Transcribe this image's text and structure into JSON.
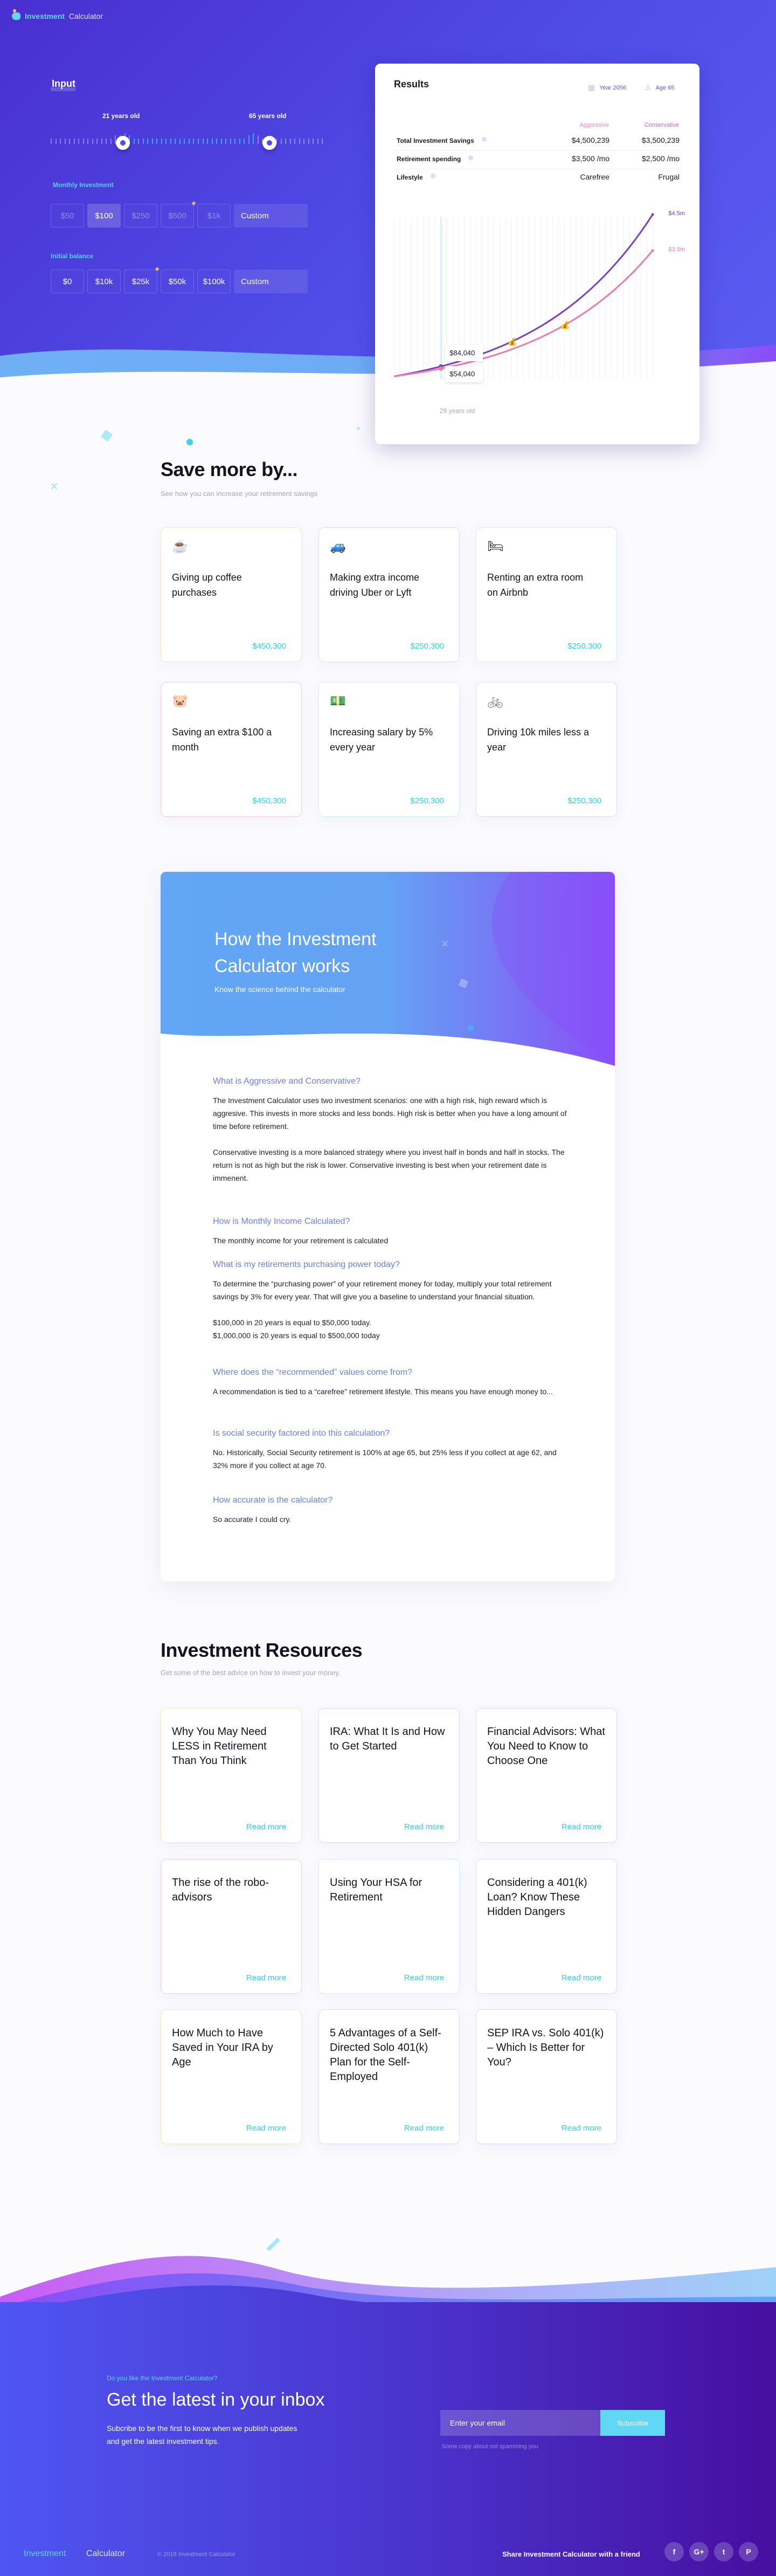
{
  "header": {
    "logo_primary": "Investment",
    "logo_secondary": "Calculator"
  },
  "input": {
    "title": "Input",
    "age_range": {
      "start_label": "21 years old",
      "end_label": "65 years old",
      "start_age": 21,
      "end_age": 65
    },
    "monthly_investment": {
      "label": "Monthly Investment",
      "options": [
        "$50",
        "$100",
        "$250",
        "$500",
        "$1k"
      ],
      "selected": "$100",
      "recommended": "$500",
      "custom_label": "Custom"
    },
    "initial_balance": {
      "label": "Initial balance",
      "options": [
        "$0",
        "$10k",
        "$25k",
        "$50k",
        "$100k"
      ],
      "recommended": "$25k",
      "custom_label": "Custom"
    }
  },
  "results": {
    "title": "Results",
    "year": "Year 2056",
    "age": "Age 65",
    "columns": [
      "Aggressive",
      "Conservative"
    ],
    "column_colors": [
      "#e58ac0",
      "#b56ccc"
    ],
    "rows": [
      {
        "label": "Total Investment Savings",
        "aggressive": "$4,500,239",
        "conservative": "$3,500,239"
      },
      {
        "label": "Retirement spending",
        "aggressive": "$3,500 /mo",
        "conservative": "$2,500 /mo"
      },
      {
        "label": "Lifestyle",
        "aggressive": "Carefree",
        "conservative": "Frugal"
      }
    ]
  },
  "chart_data": {
    "type": "line",
    "title": "",
    "xlabel": "",
    "ylabel": "",
    "x_range": [
      21,
      65
    ],
    "y_range": [
      0,
      4500000
    ],
    "grid": "vertical",
    "hover_label": "29 years old",
    "hover_age": 29,
    "series": [
      {
        "name": "Aggressive",
        "color": "#7a3fc8",
        "end_label": "$4.5m",
        "end_value": 4500000,
        "hover_value": "$84,040",
        "milestone_age": 41
      },
      {
        "name": "Conservative",
        "color": "#f07aa8",
        "end_label": "$3.5m",
        "end_value": 3500000,
        "hover_value": "$54,040",
        "milestone_age": 50
      }
    ]
  },
  "save_more": {
    "title": "Save more by...",
    "subtitle": "See how you can increase your retirement savings",
    "cards": [
      {
        "icon": "coffee-icon",
        "glyph": "☕",
        "title": "Giving up coffee purchases",
        "value": "$450,300",
        "border": "#efe6c8"
      },
      {
        "icon": "car-icon",
        "glyph": "🚙",
        "title": "Making extra income driving Uber or Lyft",
        "value": "$250,300",
        "border": "#efd4f0"
      },
      {
        "icon": "bed-icon",
        "glyph": "🛏",
        "title": "Renting an extra room on Airbnb",
        "value": "$250,300",
        "border": "#d4ecf0"
      },
      {
        "icon": "piggy-bank-icon",
        "glyph": "🐷",
        "title": "Saving an extra $100 a month",
        "value": "$450,300",
        "border": "#f5cde2"
      },
      {
        "icon": "money-icon",
        "glyph": "💵",
        "title": "Increasing salary by 5% every year",
        "value": "$250,300",
        "border": "#d4ecf4"
      },
      {
        "icon": "bicycle-icon",
        "glyph": "🚲",
        "title": "Driving 10k miles less a year",
        "value": "$250,300",
        "border": "#e6d8f0"
      }
    ]
  },
  "how_it_works": {
    "title": "How the Investment Calculator works",
    "subtitle": "Know the science behind the calculator",
    "faqs": [
      {
        "q": "What is Aggressive and Conservative?",
        "a": "The Investment Calculator uses two investment scenarios: one with a high risk, high reward which is aggresive. This invests in more stocks and less bonds. High risk is better when you have a long amount of time before retirement.\n\nConservative investing is a more balanced strategy where you invest half in bonds and half in stocks. The return is not as high but the risk is lower. Conservative investing is best when your retirement date is immenent."
      },
      {
        "q": "How is Monthly Income Calculated?",
        "a": "The monthly income for your retirement is calculated"
      },
      {
        "q": "What is my retirements purchasing power today?",
        "a": "To determine the “purchasing power” of your retirement money for today, multiply your total retirement savings by 3% for every year. That will give you a baseline to understand your financial situation.\n\n$100,000 in 20 years is equal to $50,000 today.\n$1,000,000 is 20 years is equal to $500,000 today"
      },
      {
        "q": "Where does the “recommended” values come from?",
        "a": "A recommendation is tied to a “carefree” retirement lifestyle. This means you have enough money to..."
      },
      {
        "q": "Is social security factored into this calculation?",
        "a": "No. Historically, Social Security retirement is 100% at age 65, but 25% less if you collect at age 62, and 32% more if you collect at age 70."
      },
      {
        "q": "How accurate is the calculator?",
        "a": "So accurate I could cry."
      }
    ]
  },
  "resources": {
    "title": "Investment Resources",
    "subtitle": "Get some of the best advice on how to invest your money.",
    "read_more": "Read more",
    "cards": [
      {
        "title": "Why You May Need LESS in Retirement Than You Think",
        "border": "#efe6c8"
      },
      {
        "title": "IRA: What It Is and How to Get Started",
        "border": "#efd4f0"
      },
      {
        "title": "Financial Advisors: What You Need to Know to Choose One",
        "border": "#e6d8f0"
      },
      {
        "title": "The rise of the robo-advisors",
        "border": "#f5cde2"
      },
      {
        "title": "Using Your HSA for Retirement",
        "border": "#d4ecf4"
      },
      {
        "title": "Considering a 401(k) Loan? Know These Hidden Dangers",
        "border": "#e6d8f0"
      },
      {
        "title": "How Much to Have Saved in Your IRA by Age",
        "border": "#efe6c8"
      },
      {
        "title": "5 Advantages of a Self-Directed Solo 401(k) Plan for the Self-Employed",
        "border": "#e6d8f0"
      },
      {
        "title": "SEP IRA vs. Solo 401(k) – Which Is Better for You?",
        "border": "#e6d8f0"
      }
    ]
  },
  "newsletter": {
    "kicker": "Do you like the Investment Calculator?",
    "title": "Get the latest in your inbox",
    "text": "Subcribe to be the first to know when we publish updates and get the latest investment tips.",
    "email_placeholder": "Enter your email",
    "button": "Subscribe",
    "note": "Some copy about not spamming you"
  },
  "footer": {
    "logo_primary": "Investment",
    "logo_secondary": "Calculator",
    "copyright": "© 2018 Investment Calculator",
    "share_text": "Share Investment Calculator with a friend",
    "socials": [
      {
        "name": "facebook-icon",
        "glyph": "f"
      },
      {
        "name": "google-plus-icon",
        "glyph": "G+"
      },
      {
        "name": "twitter-icon",
        "glyph": "t"
      },
      {
        "name": "pinterest-icon",
        "glyph": "P"
      }
    ]
  }
}
